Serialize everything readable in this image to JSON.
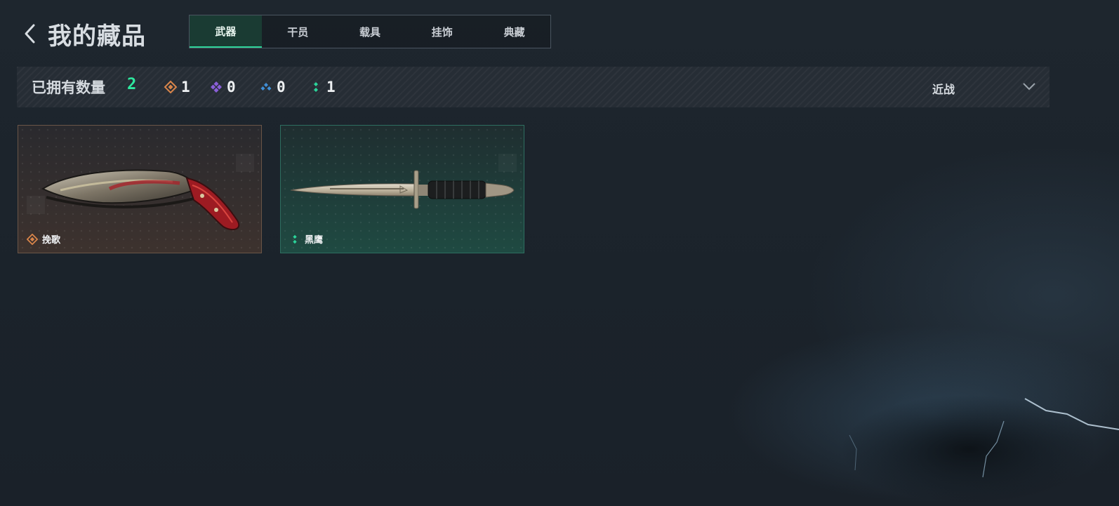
{
  "header": {
    "back_icon": "chevron-left-icon",
    "title": "我的藏品"
  },
  "tabs": [
    {
      "label": "武器",
      "active": true
    },
    {
      "label": "干员",
      "active": false
    },
    {
      "label": "载具",
      "active": false
    },
    {
      "label": "挂饰",
      "active": false
    },
    {
      "label": "典藏",
      "active": false
    }
  ],
  "stats": {
    "owned_label": "已拥有数量",
    "owned_count": "2",
    "rarities": [
      {
        "icon": "orange-diamond-icon",
        "color": "#d9854a",
        "count": "1"
      },
      {
        "icon": "purple-diamond-icon",
        "color": "#8a5fd8",
        "count": "0"
      },
      {
        "icon": "blue-diamond-icon",
        "color": "#3f8fd8",
        "count": "0"
      },
      {
        "icon": "green-diamond-icon",
        "color": "#2bd49a",
        "count": "1"
      }
    ],
    "filter_label": "近战",
    "filter_icon": "chevron-down-icon"
  },
  "items": [
    {
      "name": "挽歌",
      "rarity_icon": "orange-diamond-icon",
      "rarity_color": "#d9854a",
      "image": "kukri-knife"
    },
    {
      "name": "黑鹰",
      "rarity_icon": "green-diamond-icon",
      "rarity_color": "#2bd49a",
      "image": "combat-dagger"
    }
  ],
  "colors": {
    "accent": "#2ee89f",
    "background": "#1e262e"
  }
}
